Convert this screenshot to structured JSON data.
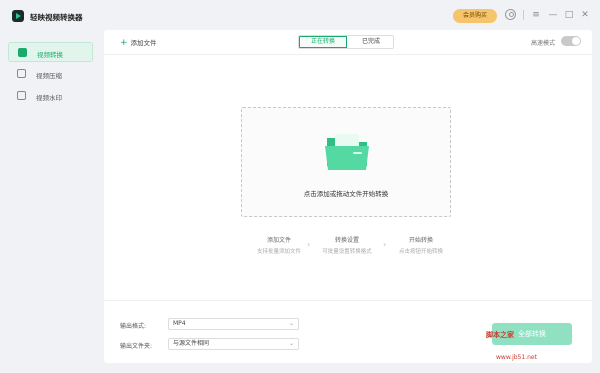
{
  "app": {
    "title": "轻映视频转换器",
    "vip_label": "会员购买"
  },
  "window_controls": {
    "menu": "≡",
    "minimize": "—",
    "maximize": "□",
    "close": "✕"
  },
  "sidebar": {
    "items": [
      {
        "label": "视频转换",
        "icon": "video-convert-icon",
        "active": true
      },
      {
        "label": "视频压缩",
        "icon": "video-compress-icon",
        "active": false
      },
      {
        "label": "视频水印",
        "icon": "watermark-icon",
        "active": false
      }
    ]
  },
  "toolbar": {
    "add_file": "添加文件",
    "tabs": [
      {
        "label": "正在转换",
        "active": true
      },
      {
        "label": "已完成",
        "active": false
      }
    ],
    "fast_mode_label": "高速模式",
    "fast_mode_on": false
  },
  "dropzone": {
    "text": "点击添加或拖动文件开始转换"
  },
  "steps": [
    {
      "title": "添加文件",
      "desc": "支持批量添加文件"
    },
    {
      "title": "转换设置",
      "desc": "可批量设置转换格式"
    },
    {
      "title": "开始转换",
      "desc": "点击按钮开始转换"
    }
  ],
  "output": {
    "format_label": "输出格式:",
    "format_value": "MP4",
    "folder_label": "输出文件夹:",
    "folder_value": "与源文件相同"
  },
  "convert_button": "全部转换",
  "watermark": {
    "text": "脚本之家",
    "sub": "www.jb51.net"
  },
  "colors": {
    "accent": "#1aaa6c",
    "vip": "#f6c56b",
    "convert_button": "#8fe1c2"
  }
}
